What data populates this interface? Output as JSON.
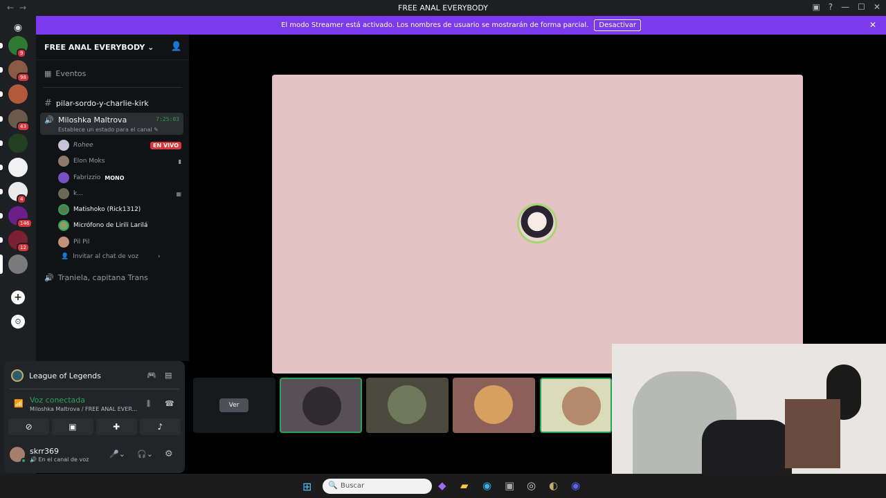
{
  "titlebar": {
    "title": "FREE ANAL EVERYBODY"
  },
  "banner": {
    "text": "El modo Streamer está activado. Los nombres de usuario se mostrarán de forma parcial.",
    "button": "Desactivar"
  },
  "rail": {
    "servers": [
      {
        "name": "server-1",
        "badge": "9"
      },
      {
        "name": "server-2",
        "badge": "98"
      },
      {
        "name": "server-3",
        "badge": ""
      },
      {
        "name": "server-4",
        "badge": "43"
      },
      {
        "name": "server-5",
        "badge": ""
      },
      {
        "name": "server-6",
        "badge": ""
      },
      {
        "name": "server-7",
        "badge": "4"
      },
      {
        "name": "server-8",
        "badge": "146"
      },
      {
        "name": "server-9",
        "badge": "12"
      },
      {
        "name": "server-10",
        "badge": ""
      }
    ]
  },
  "guild": {
    "name": "FREE ANAL EVERYBODY",
    "events": "Eventos",
    "text_channel": "pilar-sordo-y-charlie-kirk",
    "voice_channel": {
      "name": "Miloshka Maltrova",
      "timer": "7:25:03",
      "status_hint": "Establece un estado para el canal",
      "members": [
        {
          "name": "Rohee",
          "tag": "EN VIVO"
        },
        {
          "name": "Elon Moks",
          "tag": ""
        },
        {
          "name": "Fabrizzio",
          "tag": "MONO"
        },
        {
          "name": "k...",
          "tag": ""
        },
        {
          "name": "Matishoko (Rick1312)",
          "tag": ""
        },
        {
          "name": "Micrófono de Lirili Larilá",
          "tag": ""
        },
        {
          "name": "Pil Pil",
          "tag": ""
        }
      ],
      "invite": "Invitar al chat de voz"
    },
    "voice_channel_2": "Traniela, capitana Trans"
  },
  "activity": {
    "game": "League of Legends"
  },
  "voice_status": {
    "title": "Voz conectada",
    "subtitle": "Miloshka Maltrova / FREE ANAL EVER..."
  },
  "user": {
    "name": "skrr369",
    "status": "En el canal de voz"
  },
  "stage": {
    "view_label": "Ver"
  },
  "taskbar": {
    "search_placeholder": "Buscar"
  },
  "colors": {
    "accent": "#7c3aed",
    "live": "#da373c",
    "connected": "#23a55a"
  }
}
